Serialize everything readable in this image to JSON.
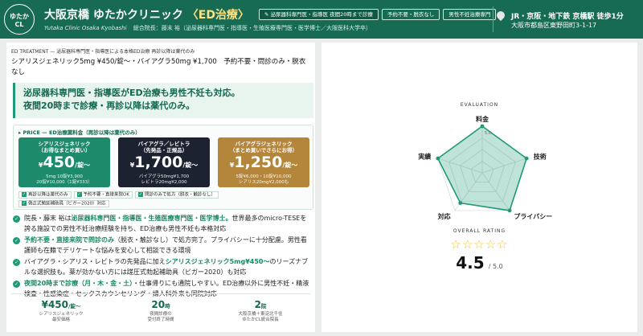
{
  "header": {
    "logo": {
      "l1": "ゆたか",
      "l2": "CL"
    },
    "title_main": "大阪京橋 ゆたかクリニック",
    "title_accent": "〈ED治療〉",
    "subtitle_en": "Yutaka Clinic Osaka Kyobashi",
    "subtitle_director": "総合院長：藤末 裕（泌尿器科専門医・指導医・生殖医療専門医・医学博士／大阪医科大学卒）",
    "tags": [
      "✎ 泌尿器科専門医・指導医 夜間20時まで診療",
      "予約不要・脱衣なし",
      "男性不妊治療専門"
    ],
    "access_line": "JR・京阪・地下鉄 京橋駅 徒歩1分",
    "address": "大阪市都島区東野田町3-1-17"
  },
  "left": {
    "kicker": "ED TREATMENT — 泌尿器科専門医・指導医による本格ED治療 再診以降は薬代のみ",
    "lead": "シアリスジェネリック5mg ¥450/錠〜・バイアグラ50mg ¥1,700　予約不要・問診のみ・脱衣なし",
    "callout_l1": "泌尿器科専門医・指導医がED治療も男性不妊も対応。",
    "callout_l2": "夜間20時まで診療・再診以降は薬代のみ。",
    "price_heading": "▸ PRICE — ED治療薬料金（再診以降は薬代のみ）",
    "cards": [
      {
        "name1": "シアリスジェネリック",
        "name2": "（お得なまとめ買い）",
        "price": "450",
        "unit": "/錠〜",
        "note1": "5mg 10錠¥3,900",
        "note2": "20錠¥10,000（1錠¥333）"
      },
      {
        "name1": "バイアグラ／レビトラ",
        "name2": "（先発品・正規品）",
        "price": "1,700",
        "unit": "/錠〜",
        "note1": "バイアグラ50mg¥1,700",
        "note2": "レビトラ20mg¥2,000"
      },
      {
        "name1": "バイアグラジェネリック",
        "name2": "（まとめ買いでさらにお得）",
        "price": "1,250",
        "unit": "/錠〜",
        "note1": "5錠¥6,000・10錠¥10,000",
        "note2": "シアリス20mg¥2,000も"
      }
    ],
    "checks": [
      "再診以降は薬代のみ",
      "予約不要・直接来院OK",
      "問診のみで処方（脱衣・触診なし）",
      "偽正式勉延補助員（ビガー2020）対応"
    ],
    "bullets": [
      {
        "pre": "院長・藤末 裕は",
        "hl": "泌尿器科専門医・指導医・生殖医療専門医・医学博士。",
        "post": "世界最多のmicro-TESEを誇る施設での男性不妊治療経験を持ち、ED治療も男性不妊も本格対応"
      },
      {
        "pre": "",
        "hl": "予約不要・直接来院で問診のみ",
        "post": "（脱衣・触診なし）で処方完了。プライバシーに十分配慮。男性看護師も在籍でデリケートな悩みを安心して相談できる環境"
      },
      {
        "pre": "バイアグラ・シアリス・レビトラの先発品に加え",
        "hl": "シアリスジェネリック5mg¥450〜",
        "post": "のリーズナブルな選択肢も。薬が効かない方には蹉圧式勃起補助具（ビガー2020）も対応"
      },
      {
        "pre": "",
        "hl": "夜間20時まで診療（月・木・金・土）",
        "post": "・仕事帰りにも通院しやすい。ED治療以外に男性不妊・精液検査・性感染症・セックスカウンセリング・婦人科外来も同院対応"
      }
    ],
    "stats": [
      {
        "value": "¥450",
        "unit": "/錠〜",
        "label1": "シアリスジェネリック",
        "label2": "最安価格"
      },
      {
        "value": "20",
        "unit": "時",
        "label1": "夜間診療の",
        "label2": "受付終了時間"
      },
      {
        "value": "2",
        "unit": "院",
        "label1": "大阪京橋＋東淀北千住",
        "label2": "ゆたかCL統合院長"
      }
    ]
  },
  "right": {
    "evaluation_label": "EVALUATION",
    "overall_label": "OVERALL RATING",
    "stars": "☆☆☆☆☆",
    "score": "4.5",
    "score_suffix": "/ 5.0"
  },
  "chart_data": {
    "type": "radar",
    "axes": [
      "料金",
      "技術",
      "プライバシー",
      "対応",
      "実績"
    ],
    "values": [
      5.0,
      5.0,
      5.0,
      4.0,
      5.0
    ],
    "max": 5.0,
    "tick_label": "5.0"
  },
  "colors": {
    "brand": "#176b52",
    "accent": "#1e9a76",
    "gold": "#b3863c",
    "star": "#f0c23b"
  }
}
